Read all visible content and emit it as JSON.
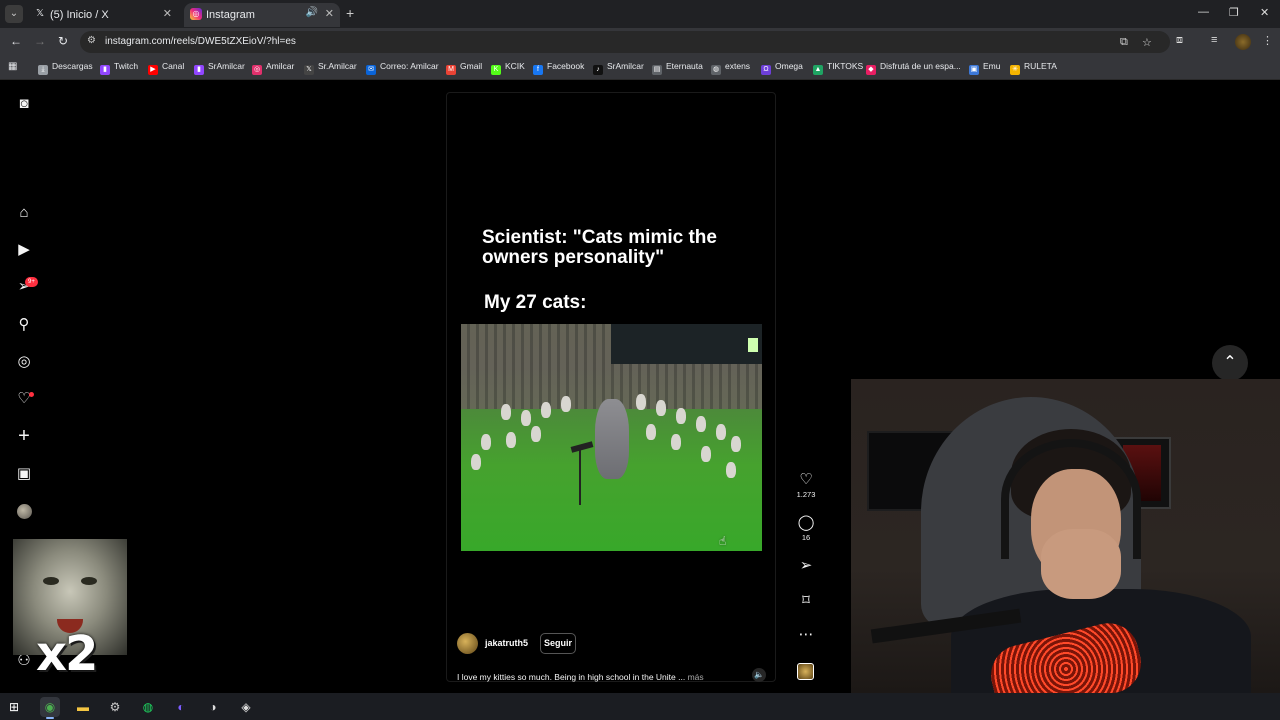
{
  "browser": {
    "tabs": [
      {
        "title": "(5) Inicio / X",
        "icon": "x-icon",
        "active": false
      },
      {
        "title": "Instagram",
        "icon": "instagram-icon",
        "active": true
      }
    ],
    "url": "instagram.com/reels/DWE5tZXEioV/?hl=es",
    "bookmarks": [
      {
        "label": "Descargas",
        "icon": "download-icon",
        "color": "#9aa0a6"
      },
      {
        "label": "Twitch",
        "icon": "twitch-icon",
        "color": "#9146ff"
      },
      {
        "label": "Canal",
        "icon": "youtube-icon",
        "color": "#ff0000"
      },
      {
        "label": "SrAmilcar",
        "icon": "twitch-icon",
        "color": "#9146ff"
      },
      {
        "label": "Amilcar",
        "icon": "instagram-icon",
        "color": "#e1306c"
      },
      {
        "label": "Sr.Amilcar",
        "icon": "x-icon",
        "color": "#444444"
      },
      {
        "label": "Correo: Amilcar",
        "icon": "outlook-icon",
        "color": "#0a64d8"
      },
      {
        "label": "Gmail",
        "icon": "gmail-icon",
        "color": "#ea4335"
      },
      {
        "label": "KCIK",
        "icon": "kick-icon",
        "color": "#53fc18"
      },
      {
        "label": "Facebook",
        "icon": "facebook-icon",
        "color": "#1877f2"
      },
      {
        "label": "SrAmilcar",
        "icon": "tiktok-icon",
        "color": "#111111"
      },
      {
        "label": "Eternauta",
        "icon": "page-icon",
        "color": "#5f6368"
      },
      {
        "label": "extens",
        "icon": "globe-icon",
        "color": "#5f6368"
      },
      {
        "label": "Omega",
        "icon": "omega-icon",
        "color": "#6d3fd8"
      },
      {
        "label": "TIKTOKS",
        "icon": "drive-icon",
        "color": "#1fa463"
      },
      {
        "label": "Disfrutá de un espa...",
        "icon": "site-icon",
        "color": "#e91e63"
      },
      {
        "label": "Emu",
        "icon": "emu-icon",
        "color": "#3c78d8"
      },
      {
        "label": "RULETA",
        "icon": "wheel-icon",
        "color": "#f4b400"
      }
    ]
  },
  "instagram": {
    "nav_badge": "9+",
    "reel": {
      "caption_line1": "Scientist: \"Cats mimic the owners personality\"",
      "caption_line2": "My 27 cats:",
      "author": "jakatruth5",
      "follow_label": "Seguir",
      "description": "I love my kitties so much. Being in high school in the Unite ...",
      "more_label": "más",
      "likes": "1.273",
      "comments": "16"
    }
  },
  "overlay": {
    "multiplier_text": "x2"
  }
}
